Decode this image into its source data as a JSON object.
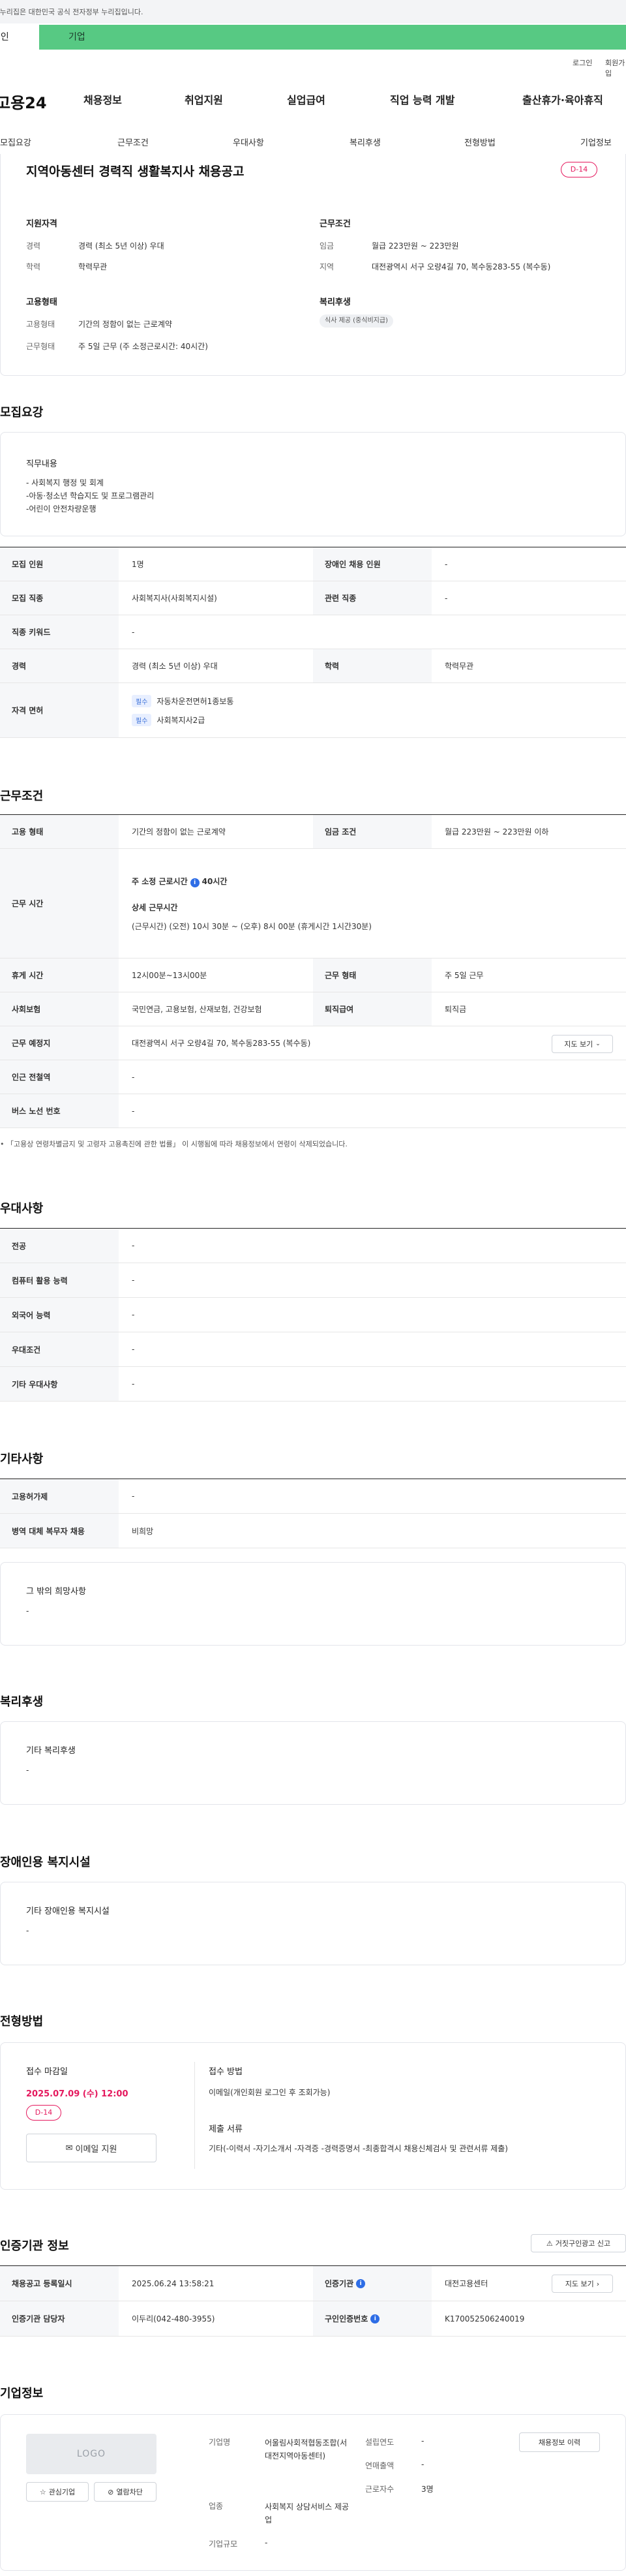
{
  "gov_banner": "이 누리집은 대한민국 공식 전자정부 누리집입니다.",
  "user_tabs": {
    "personal": "개인",
    "company": "기업"
  },
  "util": {
    "login": "로그인",
    "join": "회원가입"
  },
  "logo": "고용24",
  "gnb": [
    "채용정보",
    "취업지원",
    "실업급여",
    "직업 능력 개발",
    "출산휴가·육아휴직"
  ],
  "subnav": [
    "모집요강",
    "근무조건",
    "우대사항",
    "복리후생",
    "전형방법",
    "기업정보"
  ],
  "summary": {
    "title": "지역아동센터 경력직 생활복지사 채용공고",
    "dday": "D-14",
    "qual_heading": "지원자격",
    "qual": [
      {
        "label": "경력",
        "value": "경력 (최소 5년 이상) 우대"
      },
      {
        "label": "학력",
        "value": "학력무관"
      }
    ],
    "cond_heading": "근무조건",
    "cond": [
      {
        "label": "임금",
        "value": "월급 223만원 ~ 223만원"
      },
      {
        "label": "지역",
        "value": "대전광역시 서구 오량4길 70, 복수동283-55 (복수동)"
      }
    ],
    "emp_heading": "고용형태",
    "emp": [
      {
        "label": "고용형태",
        "value": "기간의 정함이 없는 근로계약"
      },
      {
        "label": "근무형태",
        "value": "주 5일 근무 (주 소정근로시간: 40시간)"
      }
    ],
    "welfare_heading": "복리후생",
    "welfare_chip": "식사 제공 (중식비지급)"
  },
  "recruit": {
    "heading": "모집요강",
    "duty_heading": "직무내용",
    "duty_text": "- 사회복지 행정 및 회계\n-아동·청소년 학습지도 및 프로그램관리\n-어린이 안전차량운행",
    "rows": {
      "count_label": "모집 인원",
      "count_value": "1명",
      "disabled_label": "장애인 채용 인원",
      "disabled_value": "-",
      "job_label": "모집 직종",
      "job_value": "사회복지사(사회복지시설)",
      "related_label": "관련 직종",
      "related_value": "-",
      "keyword_label": "직종 키워드",
      "keyword_value": "-",
      "career_label": "경력",
      "career_value": "경력 (최소 5년 이상) 우대",
      "edu_label": "학력",
      "edu_value": "학력무관",
      "license_label": "자격 면허",
      "license_req": "필수",
      "license_1": "자동차운전면허1종보통",
      "license_2": "사회복지사2급"
    }
  },
  "work": {
    "heading": "근무조건",
    "emp_label": "고용 형태",
    "emp_value": "기간의 정함이 없는 근로계약",
    "wage_label": "임금 조건",
    "wage_value": "월급 223만원 ~ 223만원 이하",
    "hours_label": "근무 시간",
    "hours_weekly_prefix": "주 소정 근로시간",
    "hours_weekly_value": "40시간",
    "hours_detail_heading": "상세 근무시간",
    "hours_detail": "(근무시간) (오전) 10시 30분 ~ (오후) 8시 00분 (휴게시간 1시간30분)",
    "break_label": "휴게 시간",
    "break_value": "12시00분~13시00분",
    "type_label": "근무 형태",
    "type_value": "주 5일 근무",
    "insurance_label": "사회보험",
    "insurance_value": "국민연금, 고용보험, 산재보험, 건강보험",
    "retire_label": "퇴직급여",
    "retire_value": "퇴직금",
    "place_label": "근무 예정지",
    "place_value": "대전광역시 서구 오량4길 70, 복수동283-55 (복수동)",
    "map_btn": "지도 보기",
    "subway_label": "인근 전철역",
    "subway_value": "-",
    "bus_label": "버스 노선 번호",
    "bus_value": "-",
    "notice": "「고용상 연령차별금지 및 고령자 고용촉진에 관한 법률」 이 시행됨에 따라 채용정보에서 연령이 삭제되었습니다."
  },
  "pref": {
    "heading": "우대사항",
    "rows": [
      {
        "label": "전공",
        "value": "-"
      },
      {
        "label": "컴퓨터 활용 능력",
        "value": "-"
      },
      {
        "label": "외국어 능력",
        "value": "-"
      },
      {
        "label": "우대조건",
        "value": "-"
      },
      {
        "label": "기타 우대사항",
        "value": "-"
      }
    ]
  },
  "etc": {
    "heading": "기타사항",
    "rows": [
      {
        "label": "고용허가제",
        "value": "-"
      },
      {
        "label": "병역 대체 복무자 채용",
        "value": "비희망"
      }
    ],
    "other_heading": "그 밖의 희망사항",
    "other_value": "-"
  },
  "welfare": {
    "heading": "복리후생",
    "sub": "기타 복리후생",
    "value": "-"
  },
  "disabled_fac": {
    "heading": "장애인용 복지시설",
    "sub": "기타 장애인용 복지시설",
    "value": "-"
  },
  "screening": {
    "heading": "전형방법",
    "deadline_heading": "접수 마감일",
    "deadline": "2025.07.09 (수) 12:00",
    "dday": "D-14",
    "apply_btn": "이메일 지원",
    "method_heading": "접수 방법",
    "method_value": "이메일(개인회원 로그인 후 조회가능)",
    "docs_heading": "제출 서류",
    "docs_value": "기타(-이력서 -자기소개서 -자격증 -경력증명서 -최종합격시 채용신체검사 및 관련서류 제출)"
  },
  "cert": {
    "heading": "인증기관 정보",
    "report_btn": "거짓구인광고 신고",
    "reg_label": "채용공고 등록일시",
    "reg_value": "2025.06.24 13:58:21",
    "org_label": "인증기관",
    "org_value": "대전고용센터",
    "map_btn": "지도 보기",
    "manager_label": "인증기관 담당자",
    "manager_value": "이두리(042-480-3955)",
    "id_label": "구인인증번호",
    "id_value": "K170052506240019"
  },
  "company": {
    "heading": "기업정보",
    "logo_text": "LOGO",
    "interest_btn": "관심기업",
    "block_btn": "열람차단",
    "name_label": "기업명",
    "name_value": "어울림사회적협동조합(서대전지역아동센터)",
    "industry_label": "업종",
    "industry_value": "사회복지 상담서비스 제공업",
    "size_label": "기업규모",
    "size_value": "-",
    "founded_label": "설립연도",
    "founded_value": "-",
    "sales_label": "연매출액",
    "sales_value": "-",
    "staff_label": "근로자수",
    "staff_value": "3명",
    "history_btn": "채용정보 이력"
  }
}
